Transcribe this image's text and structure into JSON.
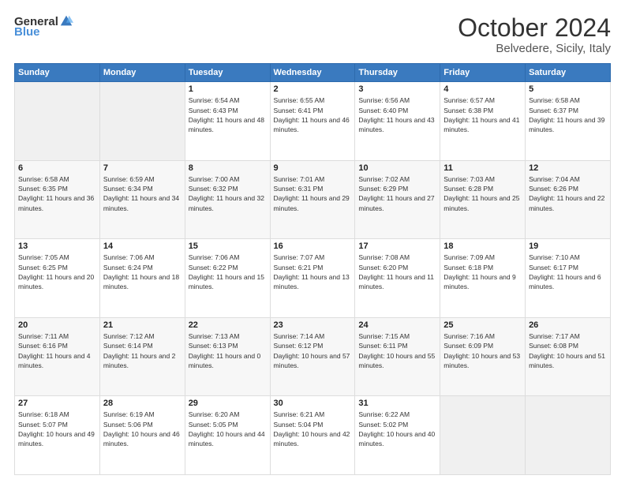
{
  "header": {
    "logo_general": "General",
    "logo_blue": "Blue",
    "title": "October 2024",
    "location": "Belvedere, Sicily, Italy"
  },
  "weekdays": [
    "Sunday",
    "Monday",
    "Tuesday",
    "Wednesday",
    "Thursday",
    "Friday",
    "Saturday"
  ],
  "weeks": [
    [
      {
        "day": "",
        "sunrise": "",
        "sunset": "",
        "daylight": ""
      },
      {
        "day": "",
        "sunrise": "",
        "sunset": "",
        "daylight": ""
      },
      {
        "day": "1",
        "sunrise": "Sunrise: 6:54 AM",
        "sunset": "Sunset: 6:43 PM",
        "daylight": "Daylight: 11 hours and 48 minutes."
      },
      {
        "day": "2",
        "sunrise": "Sunrise: 6:55 AM",
        "sunset": "Sunset: 6:41 PM",
        "daylight": "Daylight: 11 hours and 46 minutes."
      },
      {
        "day": "3",
        "sunrise": "Sunrise: 6:56 AM",
        "sunset": "Sunset: 6:40 PM",
        "daylight": "Daylight: 11 hours and 43 minutes."
      },
      {
        "day": "4",
        "sunrise": "Sunrise: 6:57 AM",
        "sunset": "Sunset: 6:38 PM",
        "daylight": "Daylight: 11 hours and 41 minutes."
      },
      {
        "day": "5",
        "sunrise": "Sunrise: 6:58 AM",
        "sunset": "Sunset: 6:37 PM",
        "daylight": "Daylight: 11 hours and 39 minutes."
      }
    ],
    [
      {
        "day": "6",
        "sunrise": "Sunrise: 6:58 AM",
        "sunset": "Sunset: 6:35 PM",
        "daylight": "Daylight: 11 hours and 36 minutes."
      },
      {
        "day": "7",
        "sunrise": "Sunrise: 6:59 AM",
        "sunset": "Sunset: 6:34 PM",
        "daylight": "Daylight: 11 hours and 34 minutes."
      },
      {
        "day": "8",
        "sunrise": "Sunrise: 7:00 AM",
        "sunset": "Sunset: 6:32 PM",
        "daylight": "Daylight: 11 hours and 32 minutes."
      },
      {
        "day": "9",
        "sunrise": "Sunrise: 7:01 AM",
        "sunset": "Sunset: 6:31 PM",
        "daylight": "Daylight: 11 hours and 29 minutes."
      },
      {
        "day": "10",
        "sunrise": "Sunrise: 7:02 AM",
        "sunset": "Sunset: 6:29 PM",
        "daylight": "Daylight: 11 hours and 27 minutes."
      },
      {
        "day": "11",
        "sunrise": "Sunrise: 7:03 AM",
        "sunset": "Sunset: 6:28 PM",
        "daylight": "Daylight: 11 hours and 25 minutes."
      },
      {
        "day": "12",
        "sunrise": "Sunrise: 7:04 AM",
        "sunset": "Sunset: 6:26 PM",
        "daylight": "Daylight: 11 hours and 22 minutes."
      }
    ],
    [
      {
        "day": "13",
        "sunrise": "Sunrise: 7:05 AM",
        "sunset": "Sunset: 6:25 PM",
        "daylight": "Daylight: 11 hours and 20 minutes."
      },
      {
        "day": "14",
        "sunrise": "Sunrise: 7:06 AM",
        "sunset": "Sunset: 6:24 PM",
        "daylight": "Daylight: 11 hours and 18 minutes."
      },
      {
        "day": "15",
        "sunrise": "Sunrise: 7:06 AM",
        "sunset": "Sunset: 6:22 PM",
        "daylight": "Daylight: 11 hours and 15 minutes."
      },
      {
        "day": "16",
        "sunrise": "Sunrise: 7:07 AM",
        "sunset": "Sunset: 6:21 PM",
        "daylight": "Daylight: 11 hours and 13 minutes."
      },
      {
        "day": "17",
        "sunrise": "Sunrise: 7:08 AM",
        "sunset": "Sunset: 6:20 PM",
        "daylight": "Daylight: 11 hours and 11 minutes."
      },
      {
        "day": "18",
        "sunrise": "Sunrise: 7:09 AM",
        "sunset": "Sunset: 6:18 PM",
        "daylight": "Daylight: 11 hours and 9 minutes."
      },
      {
        "day": "19",
        "sunrise": "Sunrise: 7:10 AM",
        "sunset": "Sunset: 6:17 PM",
        "daylight": "Daylight: 11 hours and 6 minutes."
      }
    ],
    [
      {
        "day": "20",
        "sunrise": "Sunrise: 7:11 AM",
        "sunset": "Sunset: 6:16 PM",
        "daylight": "Daylight: 11 hours and 4 minutes."
      },
      {
        "day": "21",
        "sunrise": "Sunrise: 7:12 AM",
        "sunset": "Sunset: 6:14 PM",
        "daylight": "Daylight: 11 hours and 2 minutes."
      },
      {
        "day": "22",
        "sunrise": "Sunrise: 7:13 AM",
        "sunset": "Sunset: 6:13 PM",
        "daylight": "Daylight: 11 hours and 0 minutes."
      },
      {
        "day": "23",
        "sunrise": "Sunrise: 7:14 AM",
        "sunset": "Sunset: 6:12 PM",
        "daylight": "Daylight: 10 hours and 57 minutes."
      },
      {
        "day": "24",
        "sunrise": "Sunrise: 7:15 AM",
        "sunset": "Sunset: 6:11 PM",
        "daylight": "Daylight: 10 hours and 55 minutes."
      },
      {
        "day": "25",
        "sunrise": "Sunrise: 7:16 AM",
        "sunset": "Sunset: 6:09 PM",
        "daylight": "Daylight: 10 hours and 53 minutes."
      },
      {
        "day": "26",
        "sunrise": "Sunrise: 7:17 AM",
        "sunset": "Sunset: 6:08 PM",
        "daylight": "Daylight: 10 hours and 51 minutes."
      }
    ],
    [
      {
        "day": "27",
        "sunrise": "Sunrise: 6:18 AM",
        "sunset": "Sunset: 5:07 PM",
        "daylight": "Daylight: 10 hours and 49 minutes."
      },
      {
        "day": "28",
        "sunrise": "Sunrise: 6:19 AM",
        "sunset": "Sunset: 5:06 PM",
        "daylight": "Daylight: 10 hours and 46 minutes."
      },
      {
        "day": "29",
        "sunrise": "Sunrise: 6:20 AM",
        "sunset": "Sunset: 5:05 PM",
        "daylight": "Daylight: 10 hours and 44 minutes."
      },
      {
        "day": "30",
        "sunrise": "Sunrise: 6:21 AM",
        "sunset": "Sunset: 5:04 PM",
        "daylight": "Daylight: 10 hours and 42 minutes."
      },
      {
        "day": "31",
        "sunrise": "Sunrise: 6:22 AM",
        "sunset": "Sunset: 5:02 PM",
        "daylight": "Daylight: 10 hours and 40 minutes."
      },
      {
        "day": "",
        "sunrise": "",
        "sunset": "",
        "daylight": ""
      },
      {
        "day": "",
        "sunrise": "",
        "sunset": "",
        "daylight": ""
      }
    ]
  ]
}
